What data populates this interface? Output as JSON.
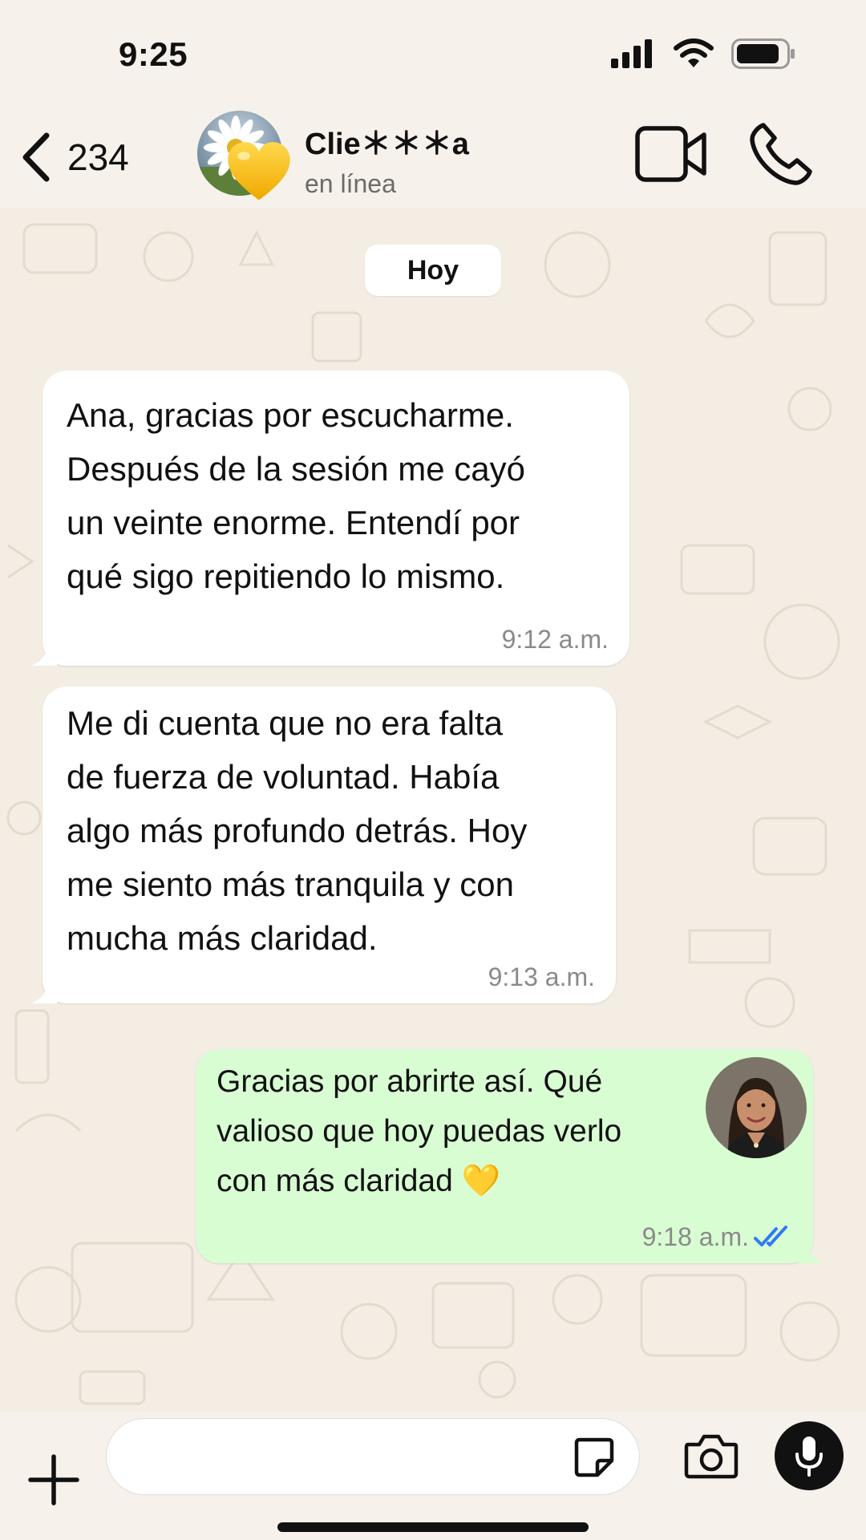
{
  "status_bar": {
    "time": "9:25"
  },
  "header": {
    "back_count": "234",
    "contact_name": "Clie＊＊＊a",
    "contact_status": "en línea"
  },
  "chat": {
    "date_chip": "Hoy",
    "messages": [
      {
        "direction": "incoming",
        "lines": [
          "Ana, gracias por escucharme.",
          "Después de la sesión me cayó",
          "un veinte enorme. Entendí por",
          "qué sigo repitiendo lo mismo."
        ],
        "time": "9:12 a.m."
      },
      {
        "direction": "incoming",
        "lines": [
          "Me di cuenta que no era falta",
          "de fuerza de voluntad. Había",
          "algo más profundo detrás. Hoy",
          "me siento más tranquila y con",
          "mucha más claridad."
        ],
        "time": "9:13 a.m."
      },
      {
        "direction": "outgoing",
        "lines": [
          "Gracias por abrirte así. Qué",
          "valioso que hoy puedas verlo",
          "con más claridad 💛"
        ],
        "time": "9:18 a.m.",
        "read_status": "double-check-read"
      }
    ]
  },
  "input_bar": {
    "placeholder": ""
  },
  "colors": {
    "chat_background": "#f3ede4",
    "incoming_bubble": "#ffffff",
    "outgoing_bubble": "#d9fdd3",
    "read_ticks": "#2f7cf0"
  },
  "icons": {
    "back": "chevron-left-icon",
    "video": "video-camera-icon",
    "call": "phone-icon",
    "attach": "plus-icon",
    "sticker": "sticker-icon",
    "camera": "camera-icon",
    "mic": "microphone-icon"
  }
}
